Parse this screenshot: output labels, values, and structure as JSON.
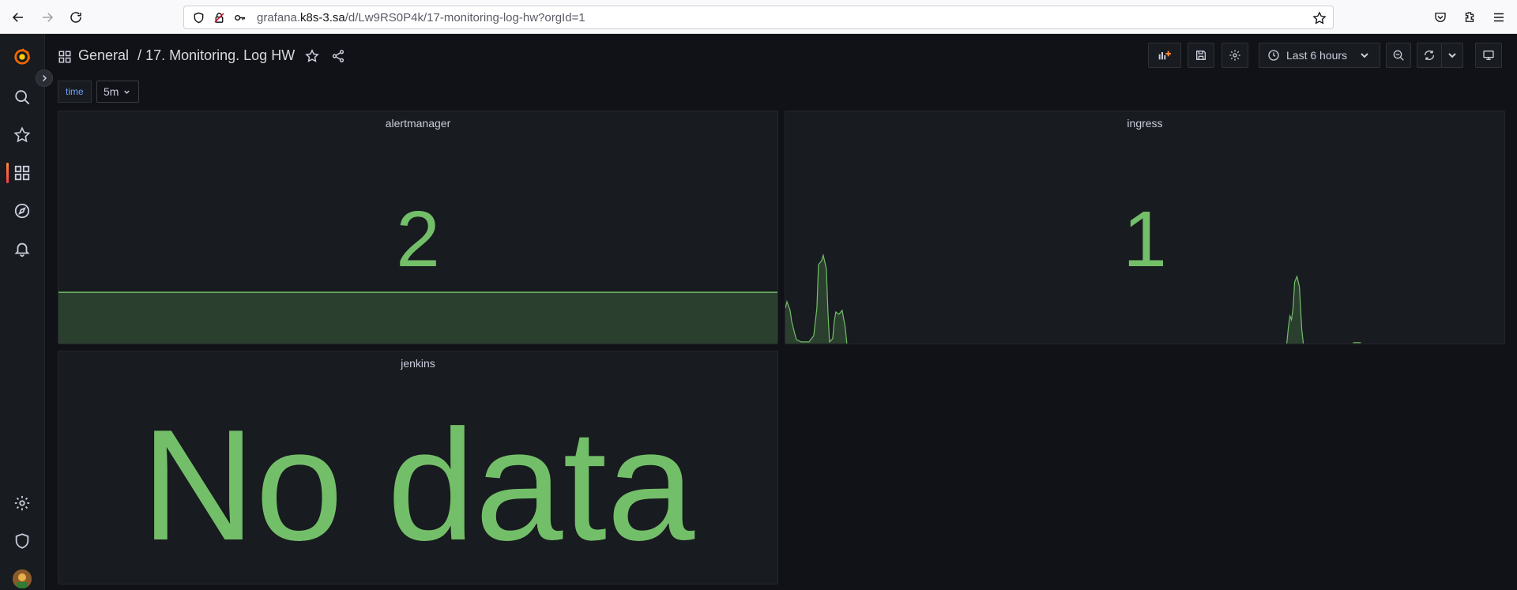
{
  "browser": {
    "url_host": "grafana.",
    "url_host_bold": "k8s-3.sa",
    "url_path": "/d/Lw9RS0P4k/17-monitoring-log-hw?orgId=1"
  },
  "sidebar": {
    "items": [
      {
        "icon": "grafana-logo-icon"
      },
      {
        "icon": "search-icon"
      },
      {
        "icon": "star-icon"
      },
      {
        "icon": "dashboards-icon"
      },
      {
        "icon": "explore-icon"
      },
      {
        "icon": "bell-icon"
      },
      {
        "icon": "gear-icon"
      },
      {
        "icon": "shield-icon"
      }
    ]
  },
  "header": {
    "folder": "General",
    "separator": "/",
    "title": "17. Monitoring. Log HW",
    "time_range": "Last 6 hours"
  },
  "variables": {
    "label": "time",
    "value": "5m"
  },
  "panels": [
    {
      "title": "alertmanager",
      "value": "2"
    },
    {
      "title": "ingress",
      "value": "1"
    },
    {
      "title": "jenkins",
      "value": "No data"
    }
  ],
  "colors": {
    "accent_green": "#73bf69",
    "background": "#111217",
    "panel": "#181b1f"
  }
}
